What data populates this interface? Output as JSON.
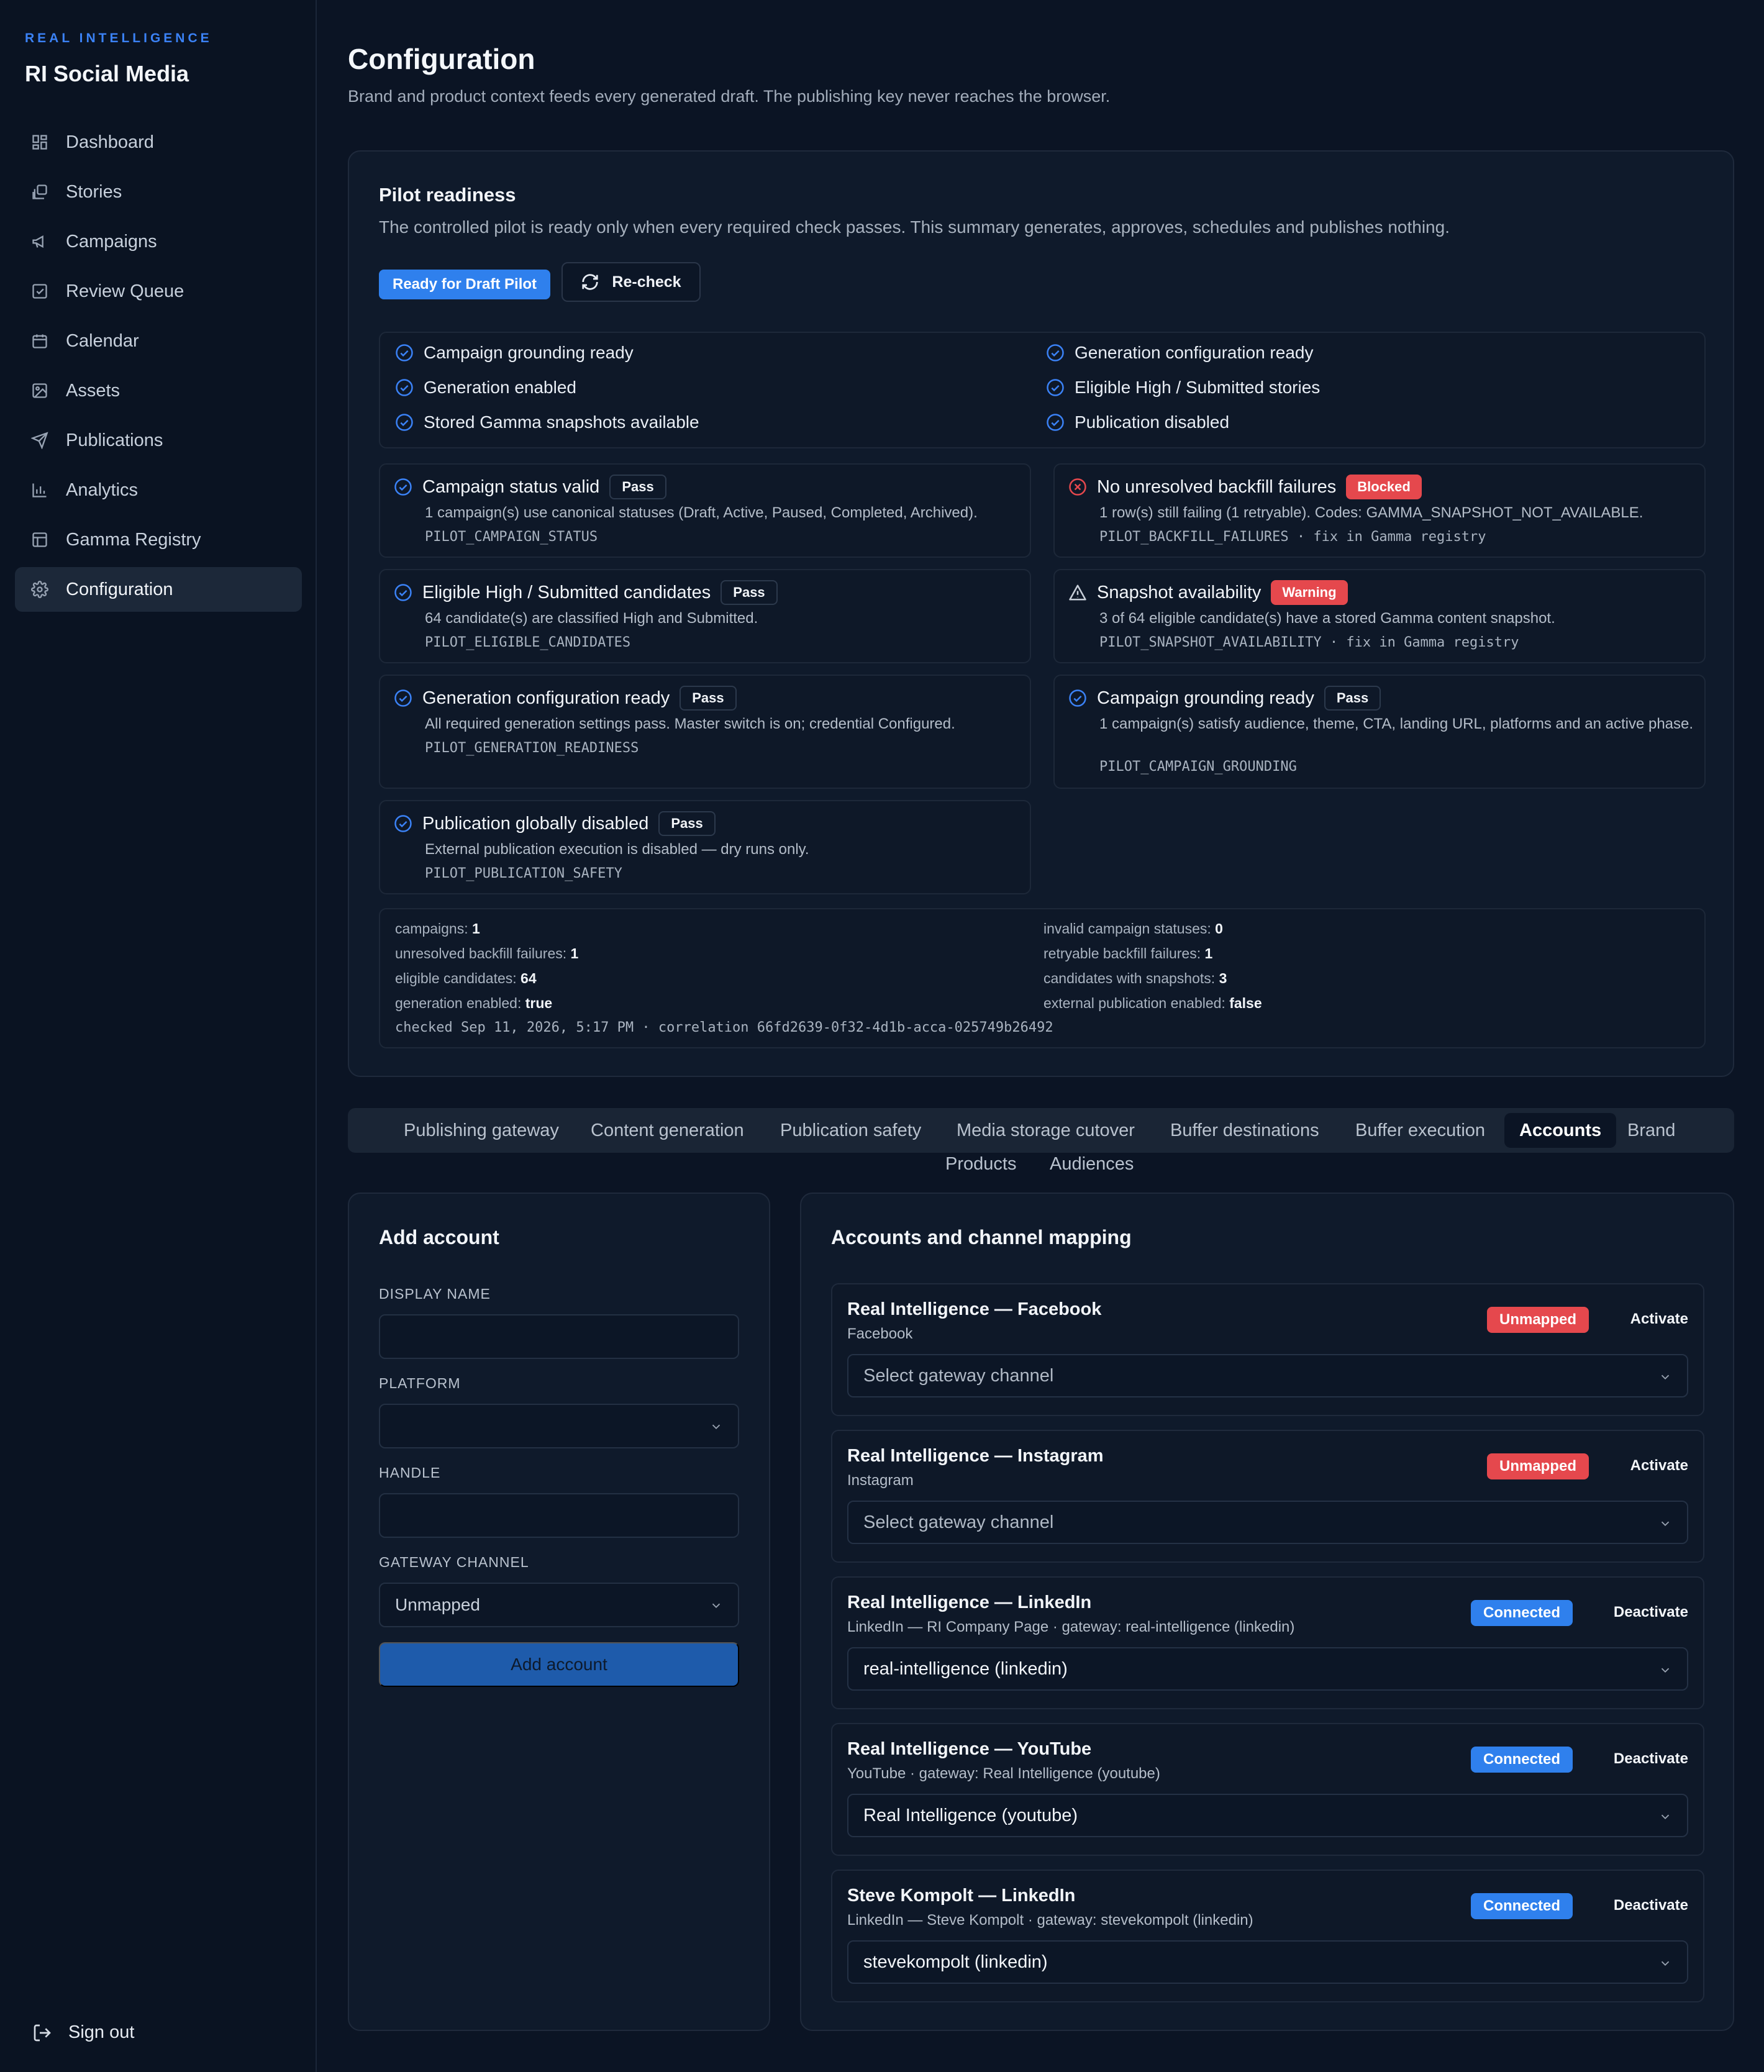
{
  "sidebar": {
    "kicker": "REAL INTELLIGENCE",
    "app_title": "RI Social Media",
    "items": [
      {
        "label": "Dashboard",
        "icon": "dashboard-icon"
      },
      {
        "label": "Stories",
        "icon": "stories-icon"
      },
      {
        "label": "Campaigns",
        "icon": "megaphone-icon"
      },
      {
        "label": "Review Queue",
        "icon": "review-icon"
      },
      {
        "label": "Calendar",
        "icon": "calendar-icon"
      },
      {
        "label": "Assets",
        "icon": "image-icon"
      },
      {
        "label": "Publications",
        "icon": "send-icon"
      },
      {
        "label": "Analytics",
        "icon": "bar-chart-icon"
      },
      {
        "label": "Gamma Registry",
        "icon": "table-icon"
      },
      {
        "label": "Configuration",
        "icon": "gear-icon",
        "active": true
      }
    ],
    "sign_out": "Sign out"
  },
  "header": {
    "title": "Configuration",
    "subtitle": "Brand and product context feeds every generated draft. The publishing key never reaches the browser."
  },
  "readiness": {
    "title": "Pilot readiness",
    "description": "The controlled pilot is ready only when every required check passes. This summary generates, approves, schedules and publishes nothing.",
    "status_label": "Ready for Draft Pilot",
    "recheck_label": "Re-check",
    "summary": [
      "Campaign grounding ready",
      "Generation enabled",
      "Stored Gamma snapshots available",
      "Generation configuration ready",
      "Eligible High / Submitted stories",
      "Publication disabled"
    ],
    "checks": [
      {
        "title": "Campaign status valid",
        "badge": "Pass",
        "status": "pass",
        "desc": "1 campaign(s) use canonical statuses (Draft, Active, Paused, Completed, Archived).",
        "code": "PILOT_CAMPAIGN_STATUS"
      },
      {
        "title": "No unresolved backfill failures",
        "badge": "Blocked",
        "status": "blocked",
        "desc": "1 row(s) still failing (1 retryable). Codes: GAMMA_SNAPSHOT_NOT_AVAILABLE.",
        "code": "PILOT_BACKFILL_FAILURES · fix in Gamma registry"
      },
      {
        "title": "Eligible High / Submitted candidates",
        "badge": "Pass",
        "status": "pass",
        "desc": "64 candidate(s) are classified High and Submitted.",
        "code": "PILOT_ELIGIBLE_CANDIDATES"
      },
      {
        "title": "Snapshot availability",
        "badge": "Warning",
        "status": "warning",
        "desc": "3 of 64 eligible candidate(s) have a stored Gamma content snapshot.",
        "code": "PILOT_SNAPSHOT_AVAILABILITY · fix in Gamma registry"
      },
      {
        "title": "Generation configuration ready",
        "badge": "Pass",
        "status": "pass",
        "desc": "All required generation settings pass. Master switch is on; credential Configured.",
        "code": "PILOT_GENERATION_READINESS"
      },
      {
        "title": "Campaign grounding ready",
        "badge": "Pass",
        "status": "pass",
        "desc": "1 campaign(s) satisfy audience, theme, CTA, landing URL, platforms and an active phase.",
        "code": "PILOT_CAMPAIGN_GROUNDING"
      },
      {
        "title": "Publication globally disabled",
        "badge": "Pass",
        "status": "pass",
        "desc": "External publication execution is disabled — dry runs only.",
        "code": "PILOT_PUBLICATION_SAFETY"
      }
    ],
    "metrics": [
      {
        "label": "campaigns:",
        "value": "1"
      },
      {
        "label": "unresolved backfill failures:",
        "value": "1"
      },
      {
        "label": "eligible candidates:",
        "value": "64"
      },
      {
        "label": "generation enabled:",
        "value": "true"
      },
      {
        "label": "invalid campaign statuses:",
        "value": "0"
      },
      {
        "label": "retryable backfill failures:",
        "value": "1"
      },
      {
        "label": "candidates with snapshots:",
        "value": "3"
      },
      {
        "label": "external publication enabled:",
        "value": "false"
      }
    ],
    "checked_line": "checked Sep 11, 2026, 5:17 PM · correlation 66fd2639-0f32-4d1b-acca-025749b26492"
  },
  "tabs": [
    "Publishing gateway",
    "Content generation",
    "Publication safety",
    "Media storage cutover",
    "Buffer destinations",
    "Buffer execution",
    "Accounts",
    "Brand",
    "Products",
    "Audiences"
  ],
  "active_tab": "Accounts",
  "add_account": {
    "title": "Add account",
    "display_name_label": "DISPLAY NAME",
    "display_name_value": "",
    "platform_label": "PLATFORM",
    "platform_value": "",
    "handle_label": "HANDLE",
    "handle_value": "",
    "gateway_label": "GATEWAY CHANNEL",
    "gateway_value": "Unmapped",
    "submit_label": "Add account"
  },
  "mapping": {
    "title": "Accounts and channel mapping",
    "accounts": [
      {
        "name": "Real Intelligence — Facebook",
        "sub": "Facebook",
        "badge": "Unmapped",
        "action": "Activate",
        "channel": "Select gateway channel"
      },
      {
        "name": "Real Intelligence — Instagram",
        "sub": "Instagram",
        "badge": "Unmapped",
        "action": "Activate",
        "channel": "Select gateway channel"
      },
      {
        "name": "Real Intelligence — LinkedIn",
        "sub": "LinkedIn — RI Company Page · gateway: real-intelligence (linkedin)",
        "badge": "Connected",
        "action": "Deactivate",
        "channel": "real-intelligence (linkedin)"
      },
      {
        "name": "Real Intelligence — YouTube",
        "sub": "YouTube · gateway: Real Intelligence (youtube)",
        "badge": "Connected",
        "action": "Deactivate",
        "channel": "Real Intelligence (youtube)"
      },
      {
        "name": "Steve Kompolt — LinkedIn",
        "sub": "LinkedIn — Steve Kompolt · gateway: stevekompolt (linkedin)",
        "badge": "Connected",
        "action": "Deactivate",
        "channel": "stevekompolt (linkedin)"
      }
    ]
  },
  "colors": {
    "accent": "#2f80ed",
    "danger": "#e5484d",
    "background": "#0b1424",
    "card": "#0f1a2b"
  }
}
